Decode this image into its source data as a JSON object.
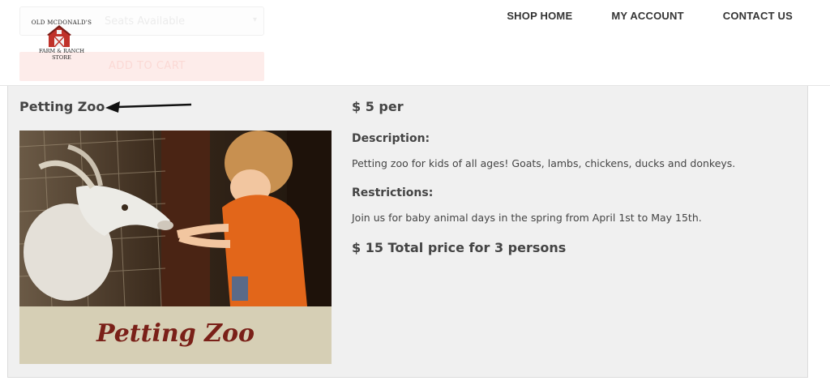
{
  "header": {
    "ghost_select_text": "Seats Available",
    "ghost_cart_label": "ADD TO CART",
    "logo": {
      "top_text": "OLD MCDONALD'S",
      "bottom_line1": "FARM & RANCH",
      "bottom_line2": "STORE",
      "icon": "barn-icon"
    },
    "nav": {
      "shop_home": "SHOP HOME",
      "my_account": "MY ACCOUNT",
      "contact_us": "CONTACT US"
    }
  },
  "product": {
    "title": "Petting Zoo",
    "arrow_icon": "left-arrow-icon",
    "image_caption": "Petting Zoo",
    "price": "$ 5 per",
    "description_label": "Description:",
    "description": "Petting zoo for kids of all ages! Goats, lambs, chickens, ducks and donkeys.",
    "restrictions_label": "Restrictions:",
    "restrictions": "Join us for baby animal days in the spring from April 1st to May 15th.",
    "total": "$ 15 Total price for 3 persons"
  },
  "colors": {
    "panel_bg": "#f0f0f0",
    "text": "#444444",
    "caption_bg": "#d6cfb5",
    "caption_text": "#7a2018",
    "barn_red": "#c0322a"
  }
}
